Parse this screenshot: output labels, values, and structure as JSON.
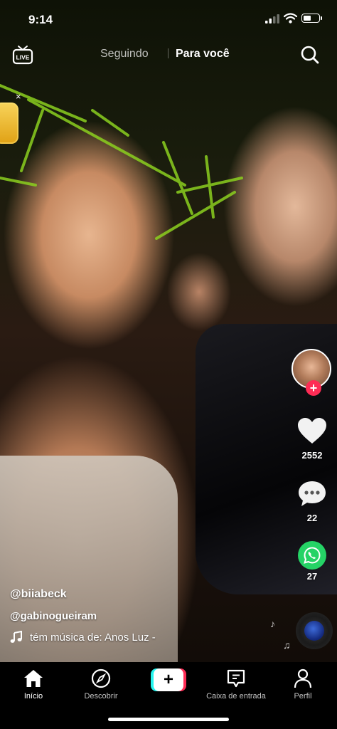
{
  "status_bar": {
    "time": "9:14"
  },
  "top_nav": {
    "live_label": "LIVE",
    "tabs": [
      {
        "label": "Seguindo",
        "active": false
      },
      {
        "label": "Para você",
        "active": true
      }
    ],
    "search_icon": "search-icon"
  },
  "coin_widget": {
    "close_glyph": "×"
  },
  "sidebar": {
    "follow_glyph": "+",
    "likes": "2552",
    "comments": "22",
    "shares": "27"
  },
  "caption": {
    "author": "@biiabeck",
    "mention": "@gabinogueiram",
    "music_text": "tém música de: Anos Luz -"
  },
  "bottom_nav": {
    "items": [
      {
        "label": "Início",
        "icon": "home-icon",
        "active": true
      },
      {
        "label": "Descobrir",
        "icon": "compass-icon",
        "active": false
      },
      {
        "label": "",
        "icon": "plus-icon",
        "active": false
      },
      {
        "label": "Caixa de entrada",
        "icon": "inbox-icon",
        "active": false
      },
      {
        "label": "Perfil",
        "icon": "profile-icon",
        "active": false
      }
    ],
    "create_glyph": "+"
  },
  "colors": {
    "brand_red": "#fe2c55",
    "brand_cyan": "#25f4ee",
    "whatsapp_green": "#25d366"
  }
}
